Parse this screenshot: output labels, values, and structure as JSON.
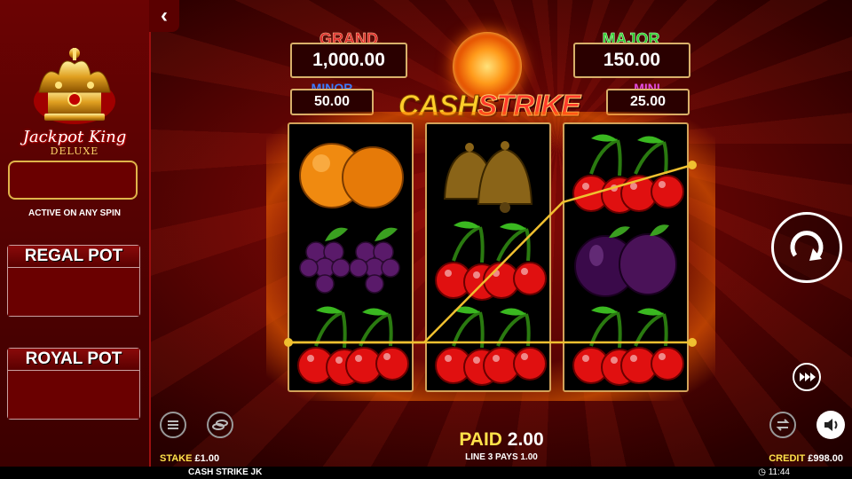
{
  "side_panel": {
    "logo_text": "Jackpot King",
    "logo_sub": "DELUXE",
    "active_text": "ACTIVE ON ANY SPIN",
    "pots": [
      {
        "title": "REGAL POT"
      },
      {
        "title": "ROYAL POT"
      }
    ]
  },
  "jackpots": {
    "grand": {
      "label": "GRAND",
      "value": "1,000.00",
      "color": "#e02a2a"
    },
    "major": {
      "label": "MAJOR",
      "value": "150.00",
      "color": "#2fd02f"
    },
    "minor": {
      "label": "MINOR",
      "value": "50.00",
      "color": "#3a7cff"
    },
    "mini": {
      "label": "MINI",
      "value": "25.00",
      "color": "#e04adc"
    }
  },
  "game_title": {
    "part1": "CASH",
    "part2": "STRIKE"
  },
  "reels": [
    [
      "orange",
      "plum-grapes",
      "cherry"
    ],
    [
      "bell",
      "cherry",
      "cherry"
    ],
    [
      "cherry",
      "plum",
      "cherry"
    ]
  ],
  "win": {
    "paid_label": "PAID",
    "paid_value": "2.00",
    "line_text": "LINE 3 PAYS 1.00"
  },
  "footer": {
    "stake_label": "STAKE",
    "stake_value": "£1.00",
    "credit_label": "CREDIT",
    "credit_value": "£998.00",
    "game_name": "CASH STRIKE JK",
    "clock": "11:44"
  },
  "colors": {
    "accent": "#ffe24a",
    "frame": "#d3a25a",
    "background": "#5a0403"
  }
}
